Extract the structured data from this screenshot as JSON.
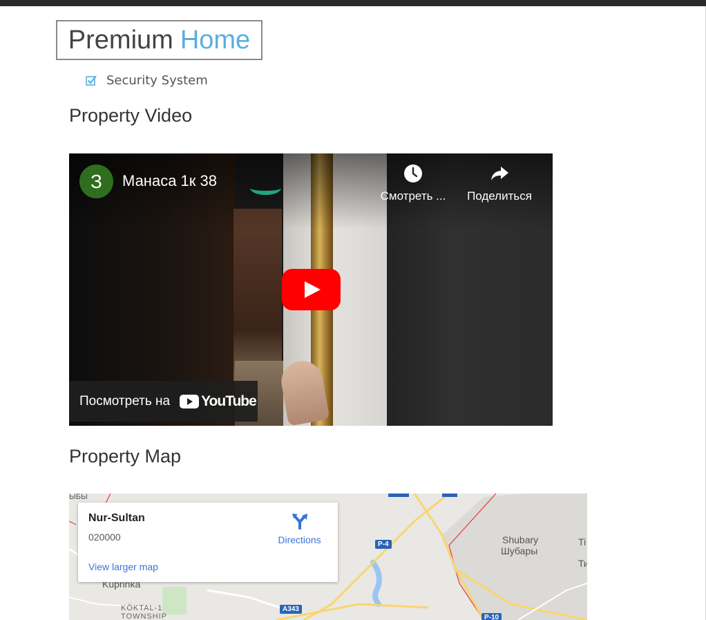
{
  "header": {
    "logo_part1": "Premium",
    "logo_part2": "Home",
    "accent_color": "#5aaee0"
  },
  "features": {
    "visible_item": "Security System",
    "icon": "checkbox-checked-icon"
  },
  "video_section": {
    "title": "Property Video",
    "player": {
      "channel_initial": "З",
      "video_title": "Манаса 1к 38",
      "watch_later_label": "Смотреть ...",
      "share_label": "Поделиться",
      "watch_on_label": "Посмотреть на",
      "platform": "YouTube",
      "play_color": "#ff0000"
    }
  },
  "map_section": {
    "title": "Property Map",
    "card": {
      "place_name": "Nur-Sultan",
      "postal_code": "020000",
      "directions_label": "Directions",
      "larger_map_label": "View larger map"
    },
    "labels": {
      "shubary_latin": "Shubary",
      "shubary_cyrillic": "Шубары",
      "kuprinka": "Kuprinka",
      "koktal_line1": "KÖKTAL-1",
      "koktal_line2": "TOWNSHIP",
      "edge_top_left": "ЫБЫ",
      "edge_right_1": "Ti",
      "edge_right_2": "Ти"
    },
    "road_shields": {
      "p4": "P-4",
      "a343": "A343",
      "p10": "P-10"
    }
  }
}
